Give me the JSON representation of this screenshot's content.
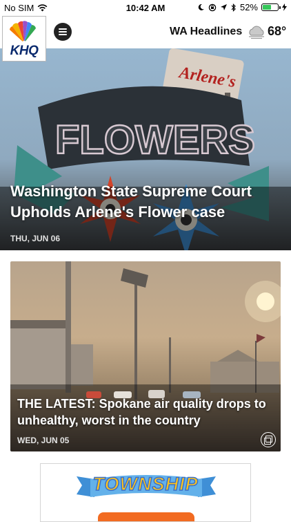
{
  "status_bar": {
    "carrier": "No SIM",
    "time": "10:42 AM",
    "battery_percent": "52%"
  },
  "header": {
    "logo_text": "KHQ",
    "title": "WA Headlines",
    "temperature": "68°"
  },
  "hero_story": {
    "sign_top": "Arlene's",
    "sign_main": "FLOWERS",
    "title": "Washington State Supreme Court Upholds Arlene's Flower case",
    "date": "THU, JUN 06"
  },
  "second_story": {
    "title": "THE LATEST: Spokane air quality drops to unhealthy, worst in the country",
    "date": "WED, JUN 05"
  },
  "ad": {
    "word": "TOWNSHIP"
  },
  "colors": {
    "brand_navy": "#0a2a6e",
    "battery_green": "#35c759",
    "ad_orange": "#f26b21",
    "ad_yellow": "#ffc41a"
  }
}
